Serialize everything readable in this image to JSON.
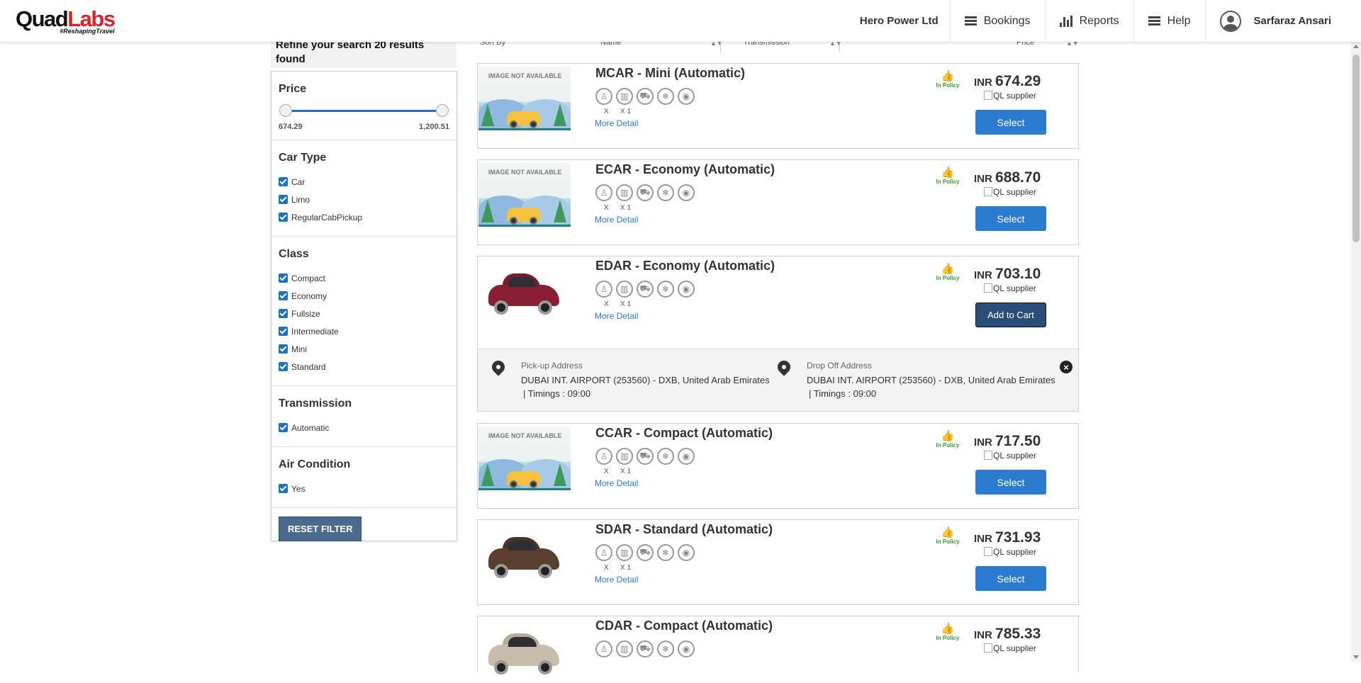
{
  "header": {
    "logo_main": "Quad",
    "logo_accent": "Labs",
    "tagline": "#ReshapingTravel",
    "company": "Hero Power Ltd",
    "nav": [
      "Bookings",
      "Reports",
      "Help"
    ],
    "user": "Sarfaraz Ansari"
  },
  "refine": "Refine your search 20 results found",
  "filters": {
    "price": {
      "title": "Price",
      "min": "674.29",
      "max": "1,200.51"
    },
    "car_type": {
      "title": "Car Type",
      "options": [
        "Car",
        "Limo",
        "RegularCabPickup"
      ]
    },
    "class": {
      "title": "Class",
      "options": [
        "Compact",
        "Economy",
        "Fullsize",
        "Intermediate",
        "Mini",
        "Standard"
      ]
    },
    "transmission": {
      "title": "Transmission",
      "options": [
        "Automatic"
      ]
    },
    "air_condition": {
      "title": "Air Condition",
      "options": [
        "Yes"
      ]
    },
    "reset_label": "RESET FILTER"
  },
  "sortbar": {
    "sort_by": "Sort By",
    "name": "Name",
    "transmission": "Transmission",
    "price": "Price"
  },
  "results": [
    {
      "title": "MCAR - Mini (Automatic)",
      "currency": "INR",
      "price": "674.29",
      "image": "IMAGE NOT AVAILABLE",
      "button": "Select"
    },
    {
      "title": "ECAR - Economy (Automatic)",
      "currency": "INR",
      "price": "688.70",
      "image": "IMAGE NOT AVAILABLE",
      "button": "Select"
    },
    {
      "title": "EDAR - Economy (Automatic)",
      "currency": "INR",
      "price": "703.10",
      "button": "Add to Cart"
    },
    {
      "title": "CCAR - Compact (Automatic)",
      "currency": "INR",
      "price": "717.50",
      "image": "IMAGE NOT AVAILABLE",
      "button": "Select"
    },
    {
      "title": "SDAR - Standard (Automatic)",
      "currency": "INR",
      "price": "731.93",
      "button": "Select"
    },
    {
      "title": "CDAR - Compact (Automatic)",
      "currency": "INR",
      "price": "785.33"
    }
  ],
  "common": {
    "in_policy": "In Policy",
    "supplier": "QL supplier",
    "more_detail": "More Detail",
    "pax_label": "X",
    "bag_label": "X 1"
  },
  "address": {
    "pickup_label": "Pick-up Address",
    "pickup_value": "DUBAI INT. AIRPORT (253560) - DXB, United Arab Emirates",
    "pickup_timing": "| Timings : 09:00",
    "dropoff_label": "Drop Off Address",
    "dropoff_value": "DUBAI INT. AIRPORT (253560) - DXB, United Arab Emirates",
    "dropoff_timing": "| Timings : 09:00"
  },
  "colors": {
    "accent": "#2b7bd0",
    "brand_red": "#d9232d",
    "policy_green": "#3a9a2b",
    "reset": "#4c6a8e"
  },
  "icons": [
    "person-icon",
    "luggage-icon",
    "car-seat-icon",
    "snowflake-icon",
    "bulb-icon"
  ]
}
